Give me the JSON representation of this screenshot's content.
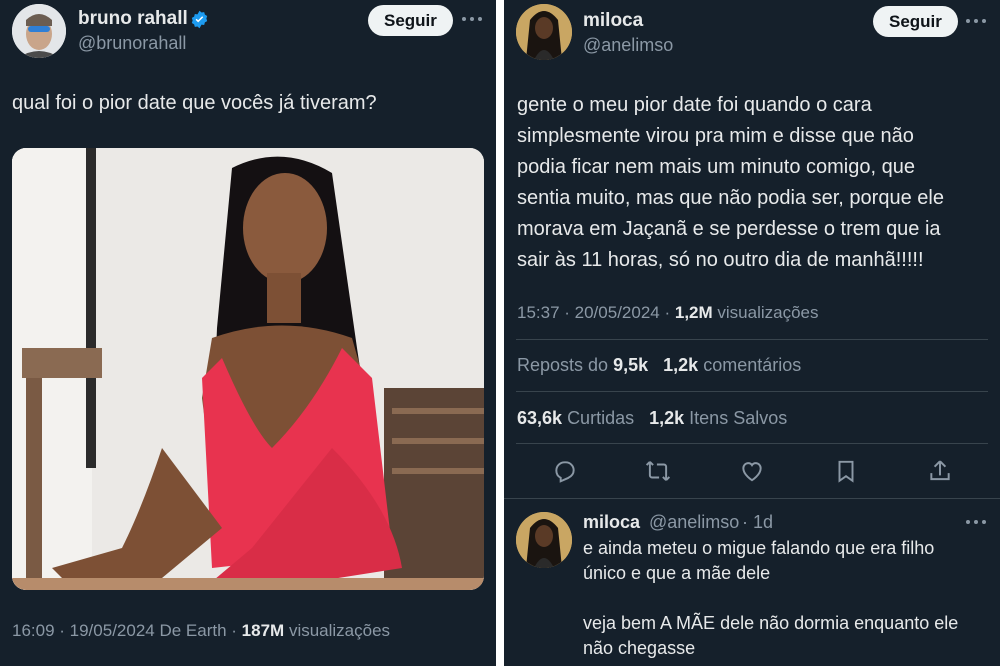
{
  "left_tweet": {
    "author": {
      "name": "bruno rahall",
      "handle": "@brunorahall",
      "verified": true
    },
    "follow_label": "Seguir",
    "text": "qual foi o pior date que vocês já tiveram?",
    "meta": {
      "time_date_source": "16:09 · 19/05/2024 De Earth ·",
      "views_count": "187M",
      "views_label": "visualizações"
    }
  },
  "right_tweet": {
    "author": {
      "name": "miloca",
      "handle": "@anelimso"
    },
    "follow_label": "Seguir",
    "text_lines": [
      "gente o meu pior date foi quando o cara",
      "simplesmente virou pra mim e disse que não",
      "podia ficar nem mais um minuto comigo, que",
      "sentia muito, mas que não podia ser, porque ele",
      "morava em Jaçanã e se perdesse o trem que ia",
      "sair às 11 horas, só no outro dia de manhã!!!!!"
    ],
    "meta": {
      "time_date": "15:37 · 20/05/2024 ·",
      "views_count": "1,2M",
      "views_label": "visualizações"
    },
    "stats": {
      "reposts_label": "Reposts do",
      "reposts_count": "9,5k",
      "comments_count": "1,2k",
      "comments_label": "comentários",
      "likes_count": "63,6k",
      "likes_label": "Curtidas",
      "saves_count": "1,2k",
      "saves_label": "Itens Salvos"
    },
    "actions": [
      "reply-icon",
      "retweet-icon",
      "like-icon",
      "bookmark-icon",
      "share-icon"
    ]
  },
  "reply": {
    "author": {
      "name": "miloca",
      "handle": "@anelimso",
      "age": "· 1d"
    },
    "paragraph1_lines": [
      "e ainda meteu o migue falando que era filho",
      "único e que a mãe dele"
    ],
    "paragraph2_lines": [
      "veja bem A MÃE dele não dormia enquanto ele",
      "não chegasse"
    ]
  },
  "colors": {
    "background": "#15202b",
    "text": "#e7e9ea",
    "secondary": "#8b98a5",
    "divider": "#38444d",
    "verified": "#1d9bf0",
    "dress": "#e8334f"
  }
}
